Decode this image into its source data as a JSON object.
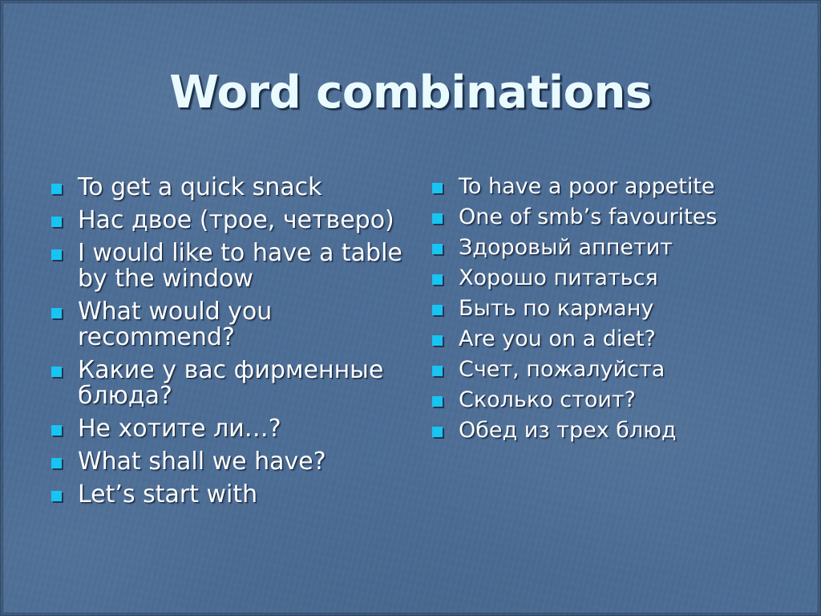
{
  "slide": {
    "title": "Word combinations",
    "background_color": "#4c6d95",
    "title_color": "#e9fbff",
    "bullet_color": "#18c4f2",
    "text_color": "#ffffff"
  },
  "left_column": {
    "items": [
      {
        "text": "To get a quick snack"
      },
      {
        "text": "Нас двое (трое, четверо)"
      },
      {
        "text": "I would like to have a table by the window"
      },
      {
        "text": "What would you recommend?"
      },
      {
        "text": "Какие у вас фирменные блюда?"
      },
      {
        "text": "Не хотите ли…?"
      },
      {
        "text": "What shall we have?"
      },
      {
        "text": "Let’s start with"
      }
    ]
  },
  "right_column": {
    "items": [
      {
        "text": "To have a poor appetite"
      },
      {
        "text": "One of smb’s favourites"
      },
      {
        "text": "Здоровый аппетит"
      },
      {
        "text": "Хорошо питаться"
      },
      {
        "text": "Быть по карману"
      },
      {
        "text": "Are you on a diet?"
      },
      {
        "text": "Счет, пожалуйста"
      },
      {
        "text": "Сколько стоит?"
      },
      {
        "text": "Обед из трех блюд"
      }
    ]
  }
}
